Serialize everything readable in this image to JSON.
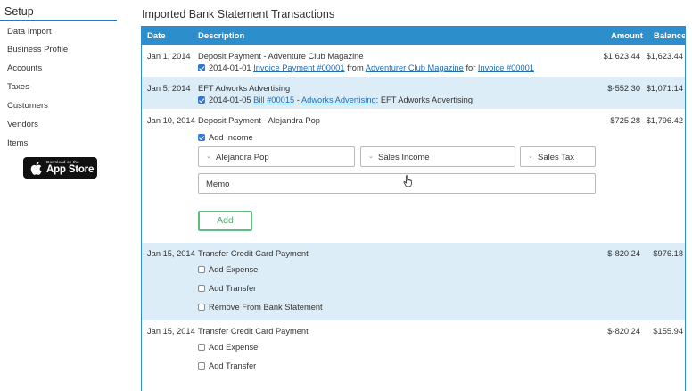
{
  "sidebar": {
    "title": "Setup",
    "items": [
      "Data Import",
      "Business Profile",
      "Accounts",
      "Taxes",
      "Customers",
      "Vendors",
      "Items"
    ],
    "appstore_small": "Download on the",
    "appstore_big": "App Store"
  },
  "main": {
    "title": "Imported Bank Statement Transactions",
    "headers": {
      "date": "Date",
      "description": "Description",
      "amount": "Amount",
      "balance": "Balance"
    }
  },
  "rows": [
    {
      "date": "Jan 1, 2014",
      "description": "Deposit Payment - Adventure Club Magazine",
      "amount": "$1,623.44",
      "balance": "$1,623.44",
      "match": {
        "prefix": "2014-01-01",
        "link1": "Invoice Payment #00001",
        "mid": "from",
        "link2": "Adventurer Club Magazine",
        "mid2": "for",
        "link3": "Invoice #00001"
      }
    },
    {
      "date": "Jan 5, 2014",
      "description": "EFT Adworks Advertising",
      "amount": "$-552.30",
      "balance": "$1,071.14",
      "match": {
        "prefix": "2014-01-05",
        "link1": "Bill #00015",
        "mid": "-",
        "link2": "Adworks Advertising",
        "suffix": ": EFT Adworks Advertising"
      }
    },
    {
      "date": "Jan 10, 2014",
      "description": "Deposit Payment - Alejandra Pop",
      "amount": "$725.28",
      "balance": "$1,796.42",
      "add_income_label": "Add Income",
      "customer_select": "Alejandra Pop",
      "account_select": "Sales Income",
      "tax_select": "Sales Tax",
      "memo_value": "Memo",
      "add_button": "Add"
    },
    {
      "date": "Jan 15, 2014",
      "description": "Transfer Credit Card Payment",
      "amount": "$-820.24",
      "balance": "$976.18",
      "options": [
        "Add Expense",
        "Add Transfer",
        "Remove From Bank Statement"
      ]
    },
    {
      "date": "Jan 15, 2014",
      "description": "Transfer Credit Card Payment",
      "amount": "$-820.24",
      "balance": "$155.94",
      "options": [
        "Add Expense",
        "Add Transfer"
      ]
    }
  ]
}
